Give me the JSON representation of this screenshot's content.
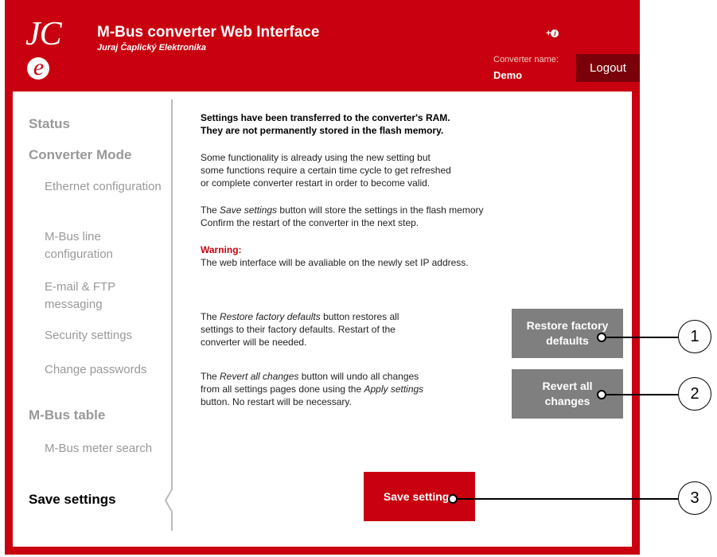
{
  "header": {
    "logo_text": "JCe",
    "title": "M-Bus converter Web Interface",
    "company": "Juraj Čaplický Elektronika",
    "info_icon": "+i",
    "converter_name_label": "Converter name:",
    "converter_name": "Demo",
    "logout_label": "Logout"
  },
  "sidebar": {
    "items": [
      {
        "label": "Status"
      },
      {
        "label": "Converter Mode"
      },
      {
        "label": "Ethernet configuration"
      },
      {
        "label": "M-Bus line configuration"
      },
      {
        "label": "E-mail & FTP messaging"
      },
      {
        "label": "Security settings"
      },
      {
        "label": "Change passwords"
      },
      {
        "label": "M-Bus table"
      },
      {
        "label": "M-Bus meter search"
      },
      {
        "label": "Save settings"
      }
    ],
    "active": "Save settings"
  },
  "main": {
    "heading_line1": "Settings have been transferred to the converter's RAM.",
    "heading_line2": "They are not permanently stored in the flash memory.",
    "para1_line1": "Some functionality is already using the new setting but",
    "para1_line2": "some functions require a certain time cycle to get refreshed",
    "para1_line3": "or complete converter restart in order to become valid.",
    "para2_pre": "The ",
    "para2_em": "Save settings",
    "para2_post": " button will store the settings in the flash memory",
    "para2_line2": "Confirm the restart of the converter in the next step.",
    "warning_label": "Warning:",
    "warning_text": "The web interface will be avaliable on the newly set IP address.",
    "restore_pre": "The ",
    "restore_em": "Restore factory defaults",
    "restore_post": " button restores all",
    "restore_line2": "settings to their factory defaults. Restart of the",
    "restore_line3": "converter will be needed.",
    "restore_btn_line1": "Restore factory",
    "restore_btn_line2": "defaults",
    "revert_pre": "The ",
    "revert_em": "Revert all changes",
    "revert_post": " button will undo all changes",
    "revert_line2_pre": "from all settings pages done using the ",
    "revert_line2_em": "Apply settings",
    "revert_line3": "button. No restart will be necessary.",
    "revert_btn_line1": "Revert all",
    "revert_btn_line2": "changes",
    "save_btn_label": "Save settings"
  },
  "callouts": [
    "1",
    "2",
    "3"
  ],
  "colors": {
    "brand_red": "#c8000f",
    "dark_red": "#7a0009",
    "button_gray": "#7f7f7f",
    "nav_gray": "#999999"
  }
}
